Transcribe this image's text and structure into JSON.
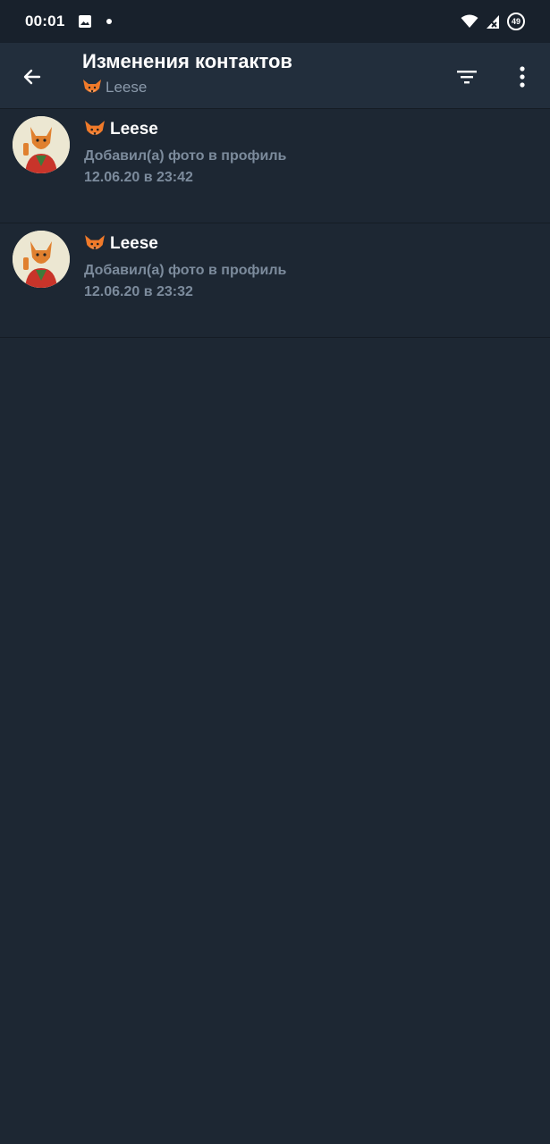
{
  "status_bar": {
    "time": "00:01",
    "battery_level": "49",
    "icons": [
      "image-icon",
      "notification-dot-icon",
      "wifi-icon",
      "signal-icon",
      "battery-icon"
    ]
  },
  "app_bar": {
    "title": "Изменения контактов",
    "subtitle": "Leese",
    "icons": [
      "back-arrow-icon",
      "filter-icon",
      "more-vert-icon"
    ]
  },
  "events": [
    {
      "name": "Leese",
      "action": "Добавил(а) фото в профиль",
      "date": "12.06.20 в 23:42"
    },
    {
      "name": "Leese",
      "action": "Добавил(а) фото в профиль",
      "date": "12.06.20 в 23:32"
    }
  ],
  "colors": {
    "background": "#1d2733",
    "app_bar": "#222e3c",
    "status_bar": "#18212c",
    "secondary_text": "#7c8b9c"
  }
}
